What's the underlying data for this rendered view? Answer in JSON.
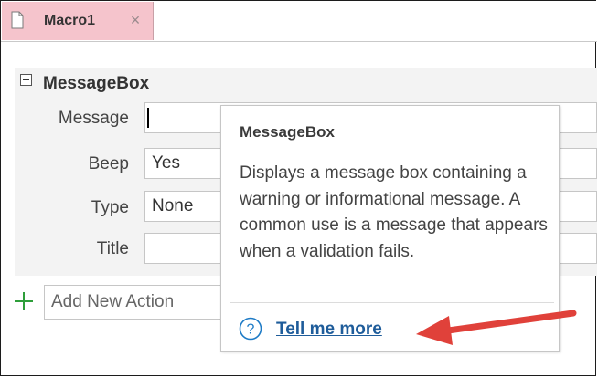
{
  "tab": {
    "title": "Macro1",
    "close": "×"
  },
  "action": {
    "name": "MessageBox",
    "arguments": [
      {
        "label": "Message",
        "value": ""
      },
      {
        "label": "Beep",
        "value": "Yes"
      },
      {
        "label": "Type",
        "value": "None"
      },
      {
        "label": "Title",
        "value": ""
      }
    ],
    "add_new_action": "Add New Action"
  },
  "tooltip": {
    "title": "MessageBox",
    "description": "Displays a message box containing a warning or informational message. A common use is a message that appears when a validation fails.",
    "link": "Tell me more"
  },
  "colors": {
    "tab_background": "#f5c4cc",
    "plus_icon": "#2e9e3a",
    "link": "#1e5c9a",
    "help_icon": "#1e7bc6",
    "annotation_arrow": "#e0413a"
  },
  "icons": [
    "document-icon",
    "collapse-icon",
    "plus-icon",
    "help-icon"
  ]
}
